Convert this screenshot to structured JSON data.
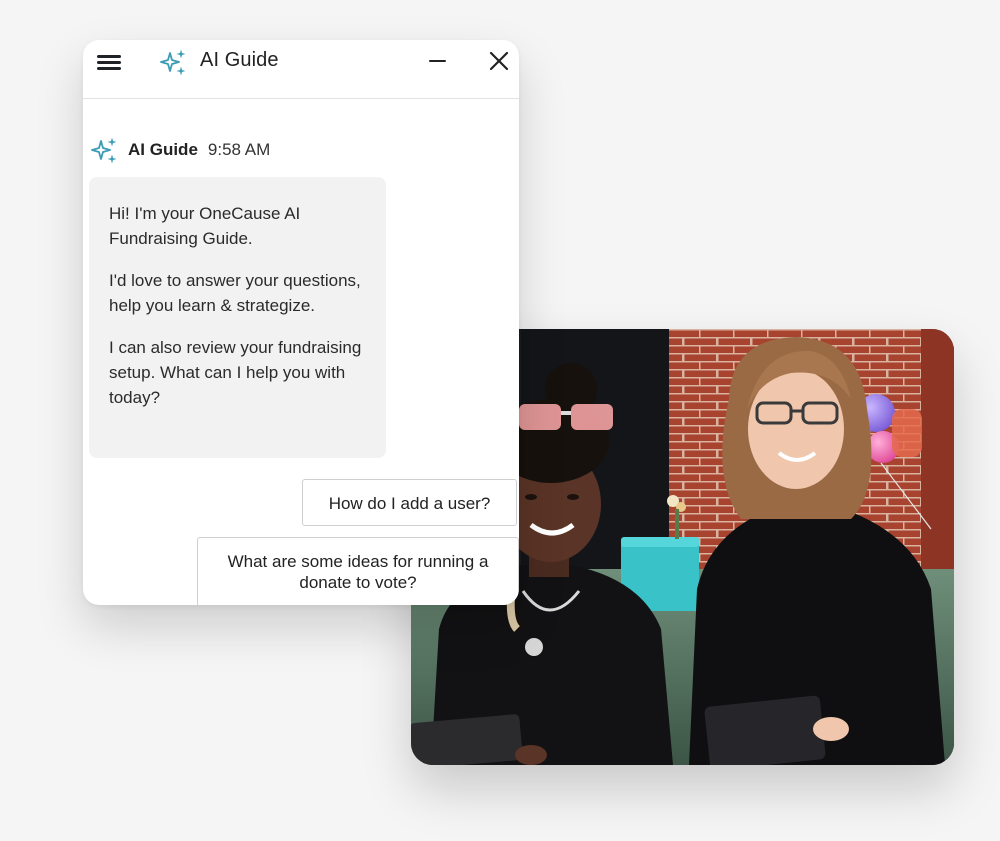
{
  "chat": {
    "title": "AI Guide",
    "icons": {
      "menu": "hamburger-menu-icon",
      "spark": "sparkle-icon",
      "minimize": "minimize-icon",
      "close": "close-icon"
    },
    "message": {
      "sender": "AI Guide",
      "time": "9:58 AM",
      "paragraphs": [
        "Hi! I'm your OneCause AI Fundraising Guide.",
        "I'd love to answer your questions, help you learn & strategize.",
        "I can also review your fundraising setup. What can I help you with today?"
      ]
    },
    "suggestions": [
      "How do I add a user?",
      "What are some ideas for running a donate to vote?"
    ]
  },
  "colors": {
    "accent": "#3a9cb5",
    "page_background": "#f5f5f5",
    "bubble_background": "#f2f2f2"
  }
}
